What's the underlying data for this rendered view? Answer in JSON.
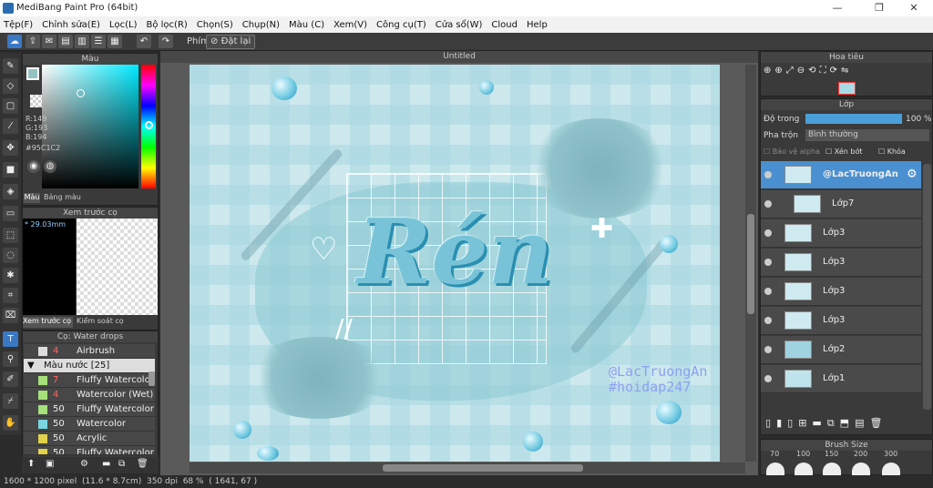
{
  "window": {
    "title": "MediBang Paint Pro (64bit)"
  },
  "menu": [
    "Tệp(F)",
    "Chỉnh sửa(E)",
    "Lọc(L)",
    "Bộ lọc(R)",
    "Chọn(S)",
    "Chụp(N)",
    "Màu (C)",
    "Xem(V)",
    "Công cụ(T)",
    "Cửa sổ(W)",
    "Cloud",
    "Help"
  ],
  "toolbar": {
    "shortcut_label": "Phím",
    "reset_label": "Đặt lại"
  },
  "color_panel": {
    "title": "Màu",
    "r": "R:149",
    "g": "G:193",
    "b": "B:194",
    "hex": "#95C1C2",
    "tab_color": "Màu",
    "tab_palette": "Bảng màu",
    "current_color": "#95c1c2"
  },
  "preview_panel": {
    "title": "Xem trước cọ",
    "size": "* 29.03mm",
    "tab_preview": "Xem trước cọ",
    "tab_control": "Kiểm soát cọ"
  },
  "brush_panel": {
    "title": "Cọ: Water drops",
    "items": [
      {
        "swatch": "#dddddd",
        "size": "4",
        "name": "Airbrush"
      },
      {
        "group": "Màu nước [25]"
      },
      {
        "swatch": "#a5e07a",
        "size": "7",
        "name": "Fluffy Watercolor"
      },
      {
        "swatch": "#a5e07a",
        "size": "4",
        "name": "Watercolor (Wet)"
      },
      {
        "swatch": "#a5e07a",
        "size": "50",
        "name": "Fluffy Watercolor"
      },
      {
        "swatch": "#7ad6e0",
        "size": "50",
        "name": "Watercolor"
      },
      {
        "swatch": "#e0d34a",
        "size": "50",
        "name": "Acrylic"
      },
      {
        "swatch": "#e0d34a",
        "size": "50",
        "name": "Fluffy Watercolor"
      }
    ]
  },
  "canvas": {
    "title": "Untitled",
    "text": "Rén",
    "watermark1": "@LacTruongAn",
    "watermark2": "#hoidap247"
  },
  "status": {
    "pixels": "1600 * 1200 pixel",
    "cm": "(11.6 * 8.7cm)",
    "dpi": "350 dpi",
    "zoom": "68 %",
    "coords": "( 1641, 67 )"
  },
  "navigator": {
    "title": "Hoa tiêu"
  },
  "layers": {
    "title": "Lớp",
    "opacity_label": "Độ trong",
    "opacity_value": "100 %",
    "opacity": 1.0,
    "blend_label": "Pha trộn",
    "blend_value": "Bình thường",
    "protect_alpha": "Bảo vệ alpha",
    "clip": "Xén bớt",
    "lock": "Khóa",
    "items": [
      "@LacTruongAn",
      "Lớp7",
      "Lớp3",
      "Lớp3",
      "Lớp3",
      "Lớp3",
      "Lớp2",
      "Lớp1"
    ]
  },
  "brush_size": {
    "title": "Brush Size",
    "values": [
      "70",
      "100",
      "150",
      "200",
      "300"
    ]
  }
}
